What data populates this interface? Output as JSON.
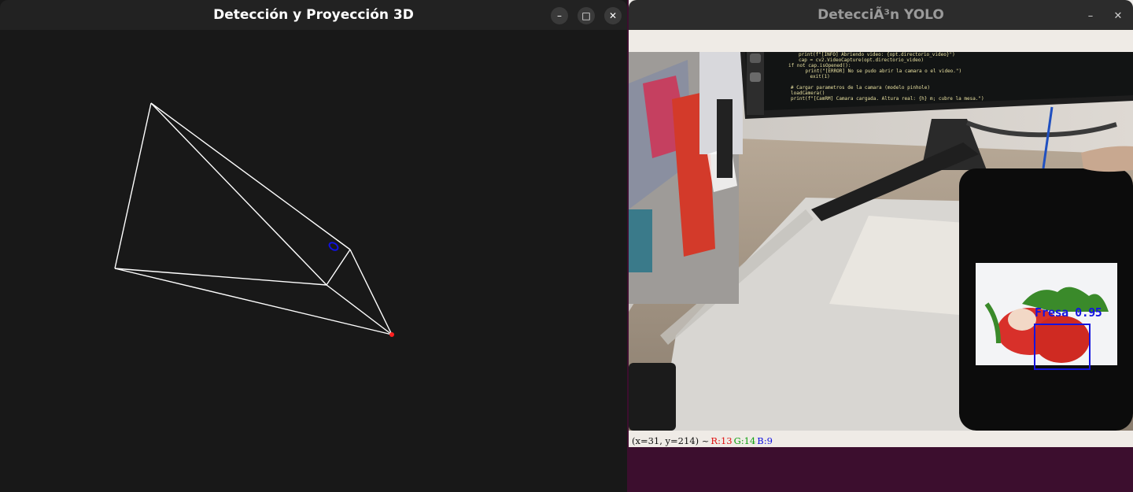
{
  "windows": {
    "projection": {
      "title": "Detección y Proyección 3D",
      "controls": {
        "minimize": "–",
        "maximize": "□",
        "close": "✕"
      }
    },
    "yolo": {
      "title": "DetecciÃ³n YOLO",
      "controls": {
        "minimize": "–",
        "close": "✕"
      },
      "detection": {
        "label": "Fresa 0.95",
        "class": "Fresa",
        "confidence": 0.95
      },
      "code_lines": [
        "print(f\"[INFO] Abriendo video: {opt.directorio_video}\")",
        "cap = cv2.VideoCapture(opt.directorio_video)",
        "if not cap.isOpened():",
        "    print(\"[ERROR] No se pudo abrir la camara o el video.\")",
        "    exit(1)",
        "",
        "# Cargar parametros de la camara (modelo pinhole)",
        "loadCamera()",
        "print(f\"[CamRM] Camara cargada. Altura real: {h} m; cubre la mesa.\")"
      ],
      "status": {
        "coords": "(x=31, y=214) ~",
        "r": "R:13",
        "g": "G:14",
        "b": "B:9"
      }
    }
  },
  "colors": {
    "detection": "#1414e0",
    "status_r": "#e01010",
    "status_g": "#10a010",
    "status_b": "#1010e0",
    "wireframe": "#ffffff",
    "apex_point": "#ff2020",
    "desktop": "#3c0e2e"
  }
}
